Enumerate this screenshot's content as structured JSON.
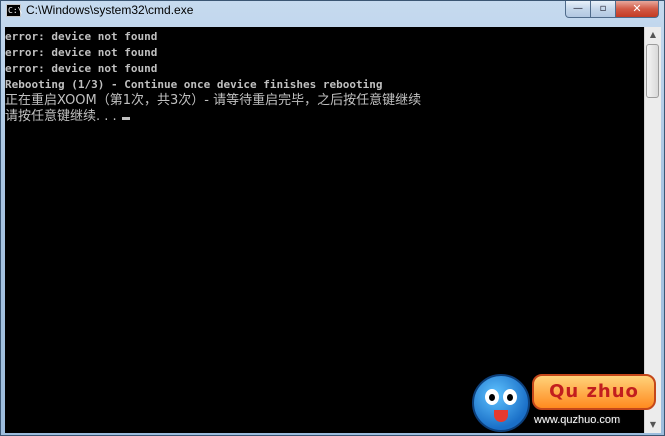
{
  "window": {
    "title": "C:\\Windows\\system32\\cmd.exe",
    "app_icon_text": "C:\\",
    "buttons": {
      "minimize": "—",
      "maximize": "▫",
      "close": "✕"
    }
  },
  "console": {
    "lines": [
      "error: device not found",
      "error: device not found",
      "error: device not found",
      "Rebooting (1/3) - Continue once device finishes rebooting",
      "正在重启XOOM（第1次，共3次）- 请等待重启完毕，之后按任意键继续",
      "请按任意键继续. . . "
    ],
    "colors": {
      "background": "#000000",
      "text": "#c0c0c0"
    }
  },
  "scrollbar": {
    "up_arrow": "▲",
    "down_arrow": "▼"
  },
  "watermark": {
    "badge_text": "Qu zhuo",
    "url": "www.quzhuo.com"
  }
}
